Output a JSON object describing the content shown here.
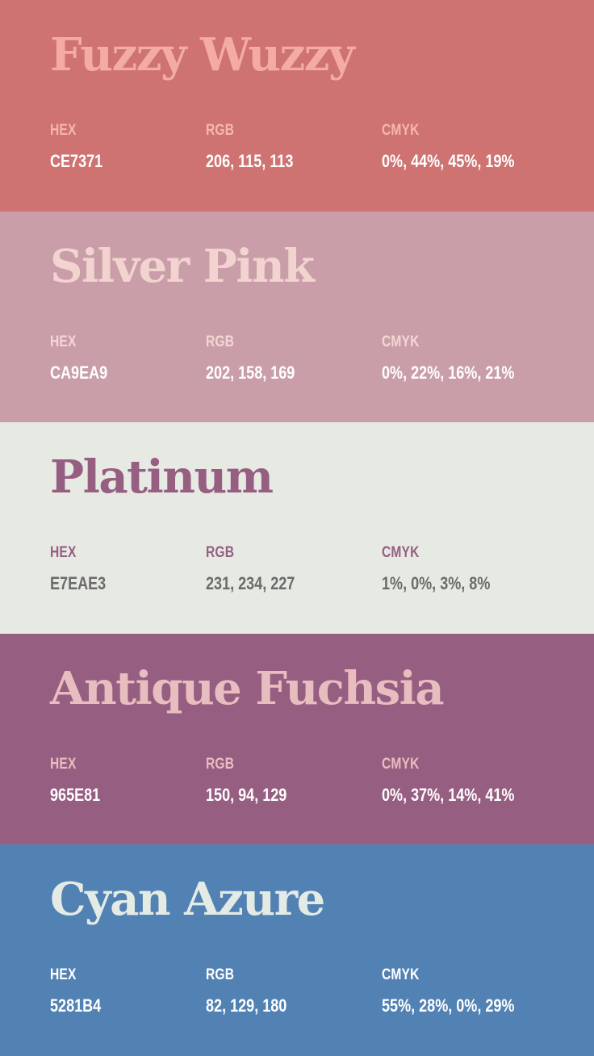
{
  "labels": {
    "hex": "HEX",
    "rgb": "RGB",
    "cmyk": "CMYK"
  },
  "swatches": [
    {
      "name": "Fuzzy Wuzzy",
      "hex": "CE7371",
      "rgb": "206, 115, 113",
      "cmyk": "0%, 44%, 45%, 19%",
      "colors": {
        "background": "#CE7371",
        "title": "#F4ABA1",
        "label": "#F6B7AC",
        "value": "#FFFFFF"
      }
    },
    {
      "name": "Silver Pink",
      "hex": "CA9EA9",
      "rgb": "202, 158, 169",
      "cmyk": "0%, 22%, 16%, 21%",
      "colors": {
        "background": "#CA9EA9",
        "title": "#F3D3D0",
        "label": "#F4D6D4",
        "value": "#FFFFFF"
      }
    },
    {
      "name": "Platinum",
      "hex": "E7EAE3",
      "rgb": "231, 234, 227",
      "cmyk": "1%, 0%, 3%, 8%",
      "colors": {
        "background": "#E7EAE3",
        "title": "#965E81",
        "label": "#965E81",
        "value": "#6B6B6B"
      }
    },
    {
      "name": "Antique Fuchsia",
      "hex": "965E81",
      "rgb": "150, 94, 129",
      "cmyk": "0%, 37%, 14%, 41%",
      "colors": {
        "background": "#965E81",
        "title": "#E8BDBF",
        "label": "#E8BDBF",
        "value": "#FFFFFF"
      }
    },
    {
      "name": "Cyan Azure",
      "hex": "5281B4",
      "rgb": "82, 129, 180",
      "cmyk": "55%, 28%, 0%, 29%",
      "colors": {
        "background": "#5281B4",
        "title": "#E4EAE4",
        "label": "#FFFFFF",
        "value": "#FFFFFF"
      }
    }
  ]
}
